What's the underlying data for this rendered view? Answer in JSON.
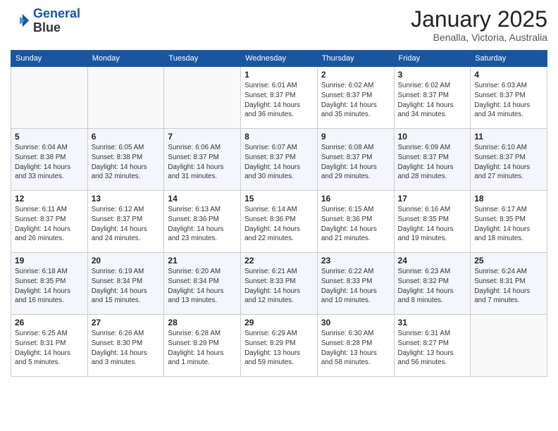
{
  "header": {
    "logo_line1": "General",
    "logo_line2": "Blue",
    "month_title": "January 2025",
    "location": "Benalla, Victoria, Australia"
  },
  "weekdays": [
    "Sunday",
    "Monday",
    "Tuesday",
    "Wednesday",
    "Thursday",
    "Friday",
    "Saturday"
  ],
  "weeks": [
    [
      {
        "day": "",
        "info": ""
      },
      {
        "day": "",
        "info": ""
      },
      {
        "day": "",
        "info": ""
      },
      {
        "day": "1",
        "info": "Sunrise: 6:01 AM\nSunset: 8:37 PM\nDaylight: 14 hours\nand 36 minutes."
      },
      {
        "day": "2",
        "info": "Sunrise: 6:02 AM\nSunset: 8:37 PM\nDaylight: 14 hours\nand 35 minutes."
      },
      {
        "day": "3",
        "info": "Sunrise: 6:02 AM\nSunset: 8:37 PM\nDaylight: 14 hours\nand 34 minutes."
      },
      {
        "day": "4",
        "info": "Sunrise: 6:03 AM\nSunset: 8:37 PM\nDaylight: 14 hours\nand 34 minutes."
      }
    ],
    [
      {
        "day": "5",
        "info": "Sunrise: 6:04 AM\nSunset: 8:38 PM\nDaylight: 14 hours\nand 33 minutes."
      },
      {
        "day": "6",
        "info": "Sunrise: 6:05 AM\nSunset: 8:38 PM\nDaylight: 14 hours\nand 32 minutes."
      },
      {
        "day": "7",
        "info": "Sunrise: 6:06 AM\nSunset: 8:37 PM\nDaylight: 14 hours\nand 31 minutes."
      },
      {
        "day": "8",
        "info": "Sunrise: 6:07 AM\nSunset: 8:37 PM\nDaylight: 14 hours\nand 30 minutes."
      },
      {
        "day": "9",
        "info": "Sunrise: 6:08 AM\nSunset: 8:37 PM\nDaylight: 14 hours\nand 29 minutes."
      },
      {
        "day": "10",
        "info": "Sunrise: 6:09 AM\nSunset: 8:37 PM\nDaylight: 14 hours\nand 28 minutes."
      },
      {
        "day": "11",
        "info": "Sunrise: 6:10 AM\nSunset: 8:37 PM\nDaylight: 14 hours\nand 27 minutes."
      }
    ],
    [
      {
        "day": "12",
        "info": "Sunrise: 6:11 AM\nSunset: 8:37 PM\nDaylight: 14 hours\nand 26 minutes."
      },
      {
        "day": "13",
        "info": "Sunrise: 6:12 AM\nSunset: 8:37 PM\nDaylight: 14 hours\nand 24 minutes."
      },
      {
        "day": "14",
        "info": "Sunrise: 6:13 AM\nSunset: 8:36 PM\nDaylight: 14 hours\nand 23 minutes."
      },
      {
        "day": "15",
        "info": "Sunrise: 6:14 AM\nSunset: 8:36 PM\nDaylight: 14 hours\nand 22 minutes."
      },
      {
        "day": "16",
        "info": "Sunrise: 6:15 AM\nSunset: 8:36 PM\nDaylight: 14 hours\nand 21 minutes."
      },
      {
        "day": "17",
        "info": "Sunrise: 6:16 AM\nSunset: 8:35 PM\nDaylight: 14 hours\nand 19 minutes."
      },
      {
        "day": "18",
        "info": "Sunrise: 6:17 AM\nSunset: 8:35 PM\nDaylight: 14 hours\nand 18 minutes."
      }
    ],
    [
      {
        "day": "19",
        "info": "Sunrise: 6:18 AM\nSunset: 8:35 PM\nDaylight: 14 hours\nand 16 minutes."
      },
      {
        "day": "20",
        "info": "Sunrise: 6:19 AM\nSunset: 8:34 PM\nDaylight: 14 hours\nand 15 minutes."
      },
      {
        "day": "21",
        "info": "Sunrise: 6:20 AM\nSunset: 8:34 PM\nDaylight: 14 hours\nand 13 minutes."
      },
      {
        "day": "22",
        "info": "Sunrise: 6:21 AM\nSunset: 8:33 PM\nDaylight: 14 hours\nand 12 minutes."
      },
      {
        "day": "23",
        "info": "Sunrise: 6:22 AM\nSunset: 8:33 PM\nDaylight: 14 hours\nand 10 minutes."
      },
      {
        "day": "24",
        "info": "Sunrise: 6:23 AM\nSunset: 8:32 PM\nDaylight: 14 hours\nand 8 minutes."
      },
      {
        "day": "25",
        "info": "Sunrise: 6:24 AM\nSunset: 8:31 PM\nDaylight: 14 hours\nand 7 minutes."
      }
    ],
    [
      {
        "day": "26",
        "info": "Sunrise: 6:25 AM\nSunset: 8:31 PM\nDaylight: 14 hours\nand 5 minutes."
      },
      {
        "day": "27",
        "info": "Sunrise: 6:26 AM\nSunset: 8:30 PM\nDaylight: 14 hours\nand 3 minutes."
      },
      {
        "day": "28",
        "info": "Sunrise: 6:28 AM\nSunset: 8:29 PM\nDaylight: 14 hours\nand 1 minute."
      },
      {
        "day": "29",
        "info": "Sunrise: 6:29 AM\nSunset: 8:29 PM\nDaylight: 13 hours\nand 59 minutes."
      },
      {
        "day": "30",
        "info": "Sunrise: 6:30 AM\nSunset: 8:28 PM\nDaylight: 13 hours\nand 58 minutes."
      },
      {
        "day": "31",
        "info": "Sunrise: 6:31 AM\nSunset: 8:27 PM\nDaylight: 13 hours\nand 56 minutes."
      },
      {
        "day": "",
        "info": ""
      }
    ]
  ]
}
